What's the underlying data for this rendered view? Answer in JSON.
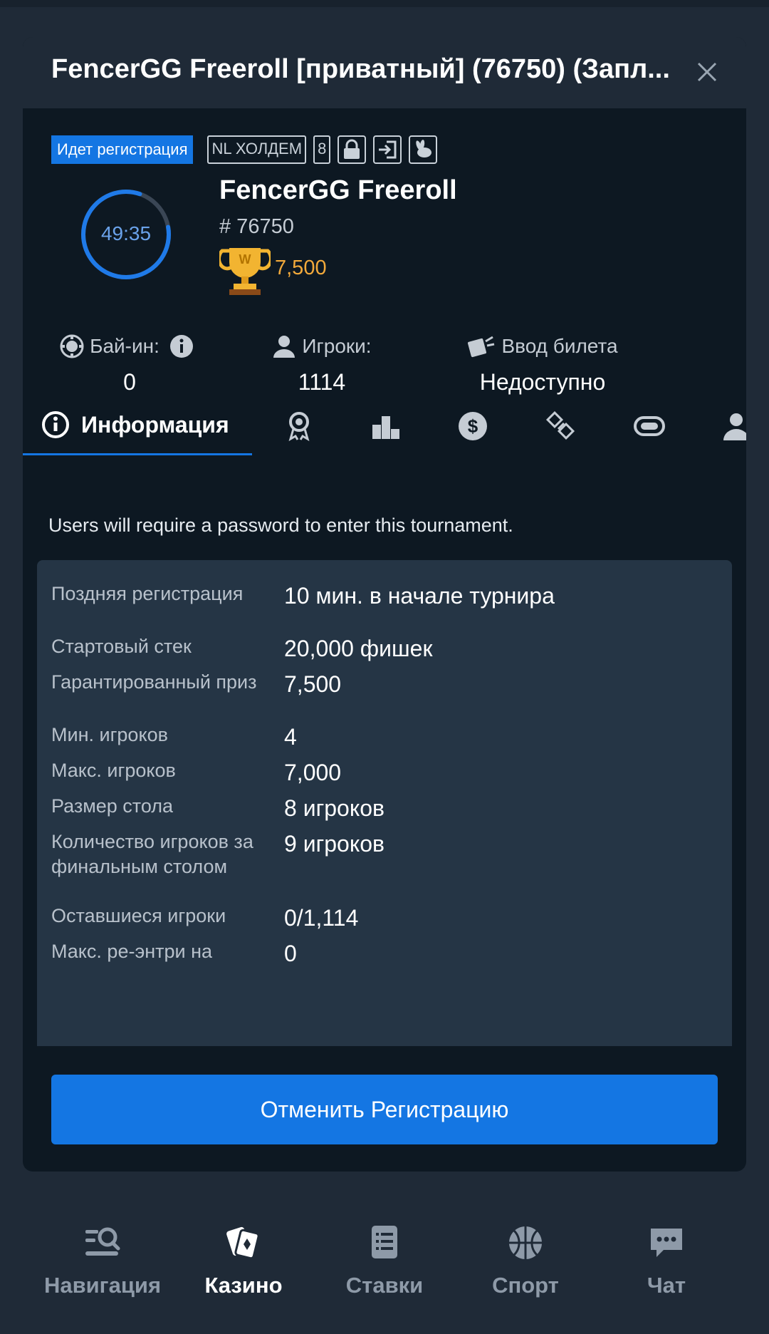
{
  "modal": {
    "title": "FencerGG Freeroll [приватный] (76750) (Запл...",
    "badges": {
      "registration": "Идет регистрация",
      "game": "NL ХОЛДЕМ",
      "table_size": "8"
    },
    "timer": "49:35",
    "tournament_name": "FencerGG Freeroll",
    "tournament_id": "# 76750",
    "prize": "7,500",
    "stats": {
      "buyin_label": "Бай-ин:",
      "buyin_value": "0",
      "players_label": "Игроки:",
      "players_value": "1114",
      "ticket_label": "Ввод билета",
      "ticket_value": "Недоступно"
    },
    "tabs": {
      "info_label": "Информация"
    },
    "note": "Users will require a password to enter this tournament.",
    "details": [
      {
        "label": "Поздняя регистрация",
        "value": "10 мин. в начале турнира"
      },
      {
        "label": "Стартовый стек",
        "value": "20,000 фишек"
      },
      {
        "label": "Гарантированный приз",
        "value": "7,500"
      },
      {
        "label": "Мин. игроков",
        "value": "4"
      },
      {
        "label": "Макс. игроков",
        "value": "7,000"
      },
      {
        "label": "Размер стола",
        "value": "8 игроков"
      },
      {
        "label": "Количество игроков за финальным столом",
        "value": "9 игроков"
      },
      {
        "label": "Оставшиеся игроки",
        "value": "0/1,114"
      },
      {
        "label": "Макс. ре-энтри на",
        "value": "0"
      }
    ],
    "cancel_button": "Отменить Регистрацию"
  },
  "bottom_nav": {
    "items": [
      {
        "label": "Навигация",
        "icon": "navigation-search-icon"
      },
      {
        "label": "Казино",
        "icon": "casino-cards-icon"
      },
      {
        "label": "Ставки",
        "icon": "bets-list-icon"
      },
      {
        "label": "Спорт",
        "icon": "sport-ball-icon"
      },
      {
        "label": "Чат",
        "icon": "chat-bubble-icon"
      }
    ],
    "active_index": 1
  },
  "colors": {
    "accent": "#1476e3",
    "prize": "#f2a93b",
    "background": "#1f2a37",
    "panel": "#0d1822"
  }
}
